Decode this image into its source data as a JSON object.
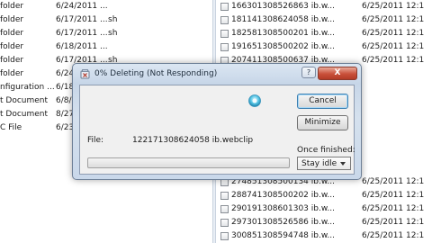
{
  "left_pane": {
    "rows": [
      {
        "name": "folder",
        "date": "6/24/2011 ...",
        "extra": ""
      },
      {
        "name": "folder",
        "date": "6/17/2011 ...",
        "extra": "sh"
      },
      {
        "name": "folder",
        "date": "6/17/2011 ...",
        "extra": "sh"
      },
      {
        "name": "folder",
        "date": "6/18/2011 ...",
        "extra": ""
      },
      {
        "name": "folder",
        "date": "6/17/2011 ...",
        "extra": "sh"
      },
      {
        "name": "folder",
        "date": "6/24",
        "extra": ""
      },
      {
        "name": "nfiguration ...",
        "date": "6/18/",
        "extra": ""
      },
      {
        "name": "t Document",
        "date": "6/8/2",
        "extra": ""
      },
      {
        "name": "t Document",
        "date": "8/27/",
        "extra": ""
      },
      {
        "name": "C File",
        "date": "6/23/",
        "extra": ""
      }
    ]
  },
  "right_pane": {
    "rows": [
      {
        "name": "166301308526863 ib.w...",
        "date": "6/25/2011 12:1"
      },
      {
        "name": "181141308624058 ib.w...",
        "date": "6/25/2011 12:1"
      },
      {
        "name": "182581308500201 ib.w...",
        "date": "6/25/2011 12:1"
      },
      {
        "name": "191651308500202 ib.w...",
        "date": "6/25/2011 12:1"
      },
      {
        "name": "207411308500637 ib.w...",
        "date": "6/25/2011 12:1"
      },
      {
        "name": "",
        "date": ""
      },
      {
        "name": "",
        "date": ""
      },
      {
        "name": "",
        "date": ""
      },
      {
        "name": "",
        "date": ""
      },
      {
        "name": "",
        "date": ""
      },
      {
        "name": "",
        "date": ""
      },
      {
        "name": "",
        "date": ""
      },
      {
        "name": "",
        "date": ""
      },
      {
        "name": "274851308500134 ib.w...",
        "date": "6/25/2011 12:1"
      },
      {
        "name": "288741308500202 ib.w...",
        "date": "6/25/2011 12:1"
      },
      {
        "name": "290191308601303 ib.w...",
        "date": "6/25/2011 12:1"
      },
      {
        "name": "297301308526586 ib.w...",
        "date": "6/25/2011 12:1"
      },
      {
        "name": "300851308594748 ib.w...",
        "date": "6/25/2011 12:1"
      }
    ]
  },
  "dialog": {
    "title": "0% Deleting (Not Responding)",
    "help_label": "?",
    "close_label": "X",
    "cancel_label": "Cancel",
    "minimize_label": "Minimize",
    "file_label": "File:",
    "file_value": "122171308624058 ib.webclip",
    "once_finished_label": "Once finished:",
    "once_finished_value": "Stay idle",
    "progress_fraction": 0.0,
    "icons": {
      "title": "deleting-app-icon",
      "spinner": "busy-spinner-icon"
    }
  },
  "colors": {
    "close_button": "#c9503a",
    "progress_fill": "#37b33d",
    "default_button_border": "#3c7fb1"
  }
}
